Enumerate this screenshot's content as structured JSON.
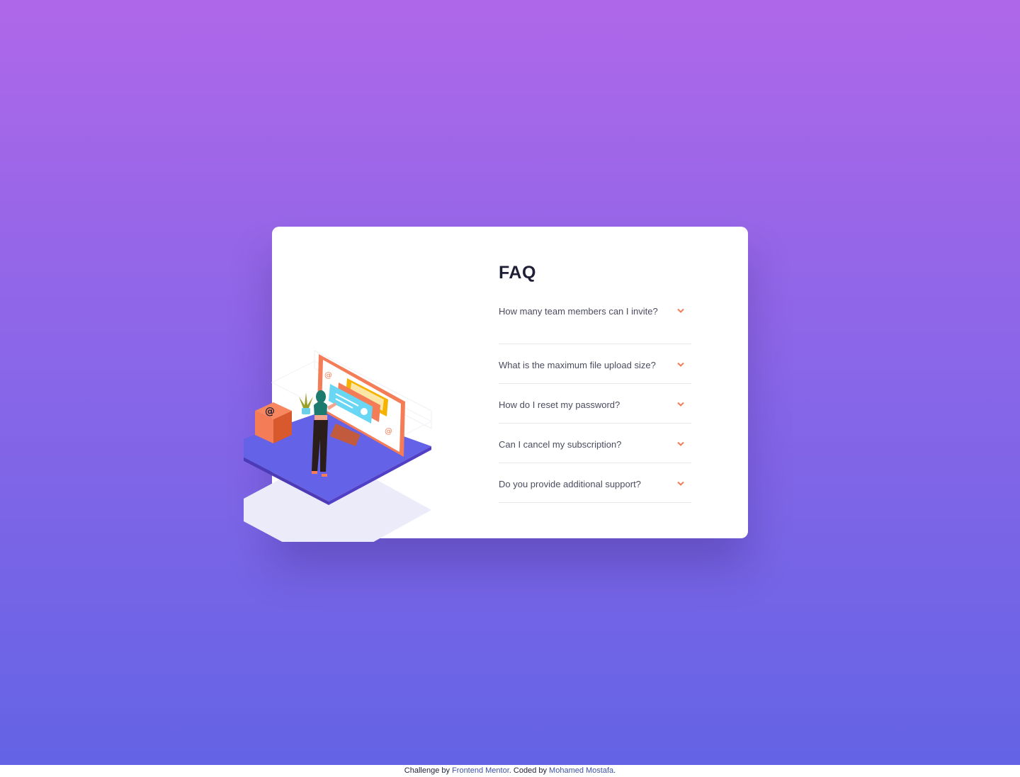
{
  "colors": {
    "gradient_top": "#af67e9",
    "gradient_bottom": "#6463e5",
    "card": "#ffffff",
    "heading": "#1e1f36",
    "question": "#4b4c5f",
    "accent": "#f47c57",
    "divider": "#e8e8ea",
    "link": "#3e52a3"
  },
  "illustration": {
    "icon": "woman-at-computer-illustration",
    "box_glyph": "@",
    "screen_glyphs": [
      "@",
      "@"
    ]
  },
  "faq": {
    "title": "FAQ",
    "chevron_icon": "chevron-down-icon",
    "items": [
      {
        "question": "How many team members can I invite?"
      },
      {
        "question": "What is the maximum file upload size?"
      },
      {
        "question": "How do I reset my password?"
      },
      {
        "question": "Can I cancel my subscription?"
      },
      {
        "question": "Do you provide additional support?"
      }
    ]
  },
  "footer": {
    "prefix": "Challenge by",
    "link1": "Frontend Mentor",
    "middle": ". Coded by",
    "link2": "Mohamed Mostafa",
    "suffix": "."
  }
}
